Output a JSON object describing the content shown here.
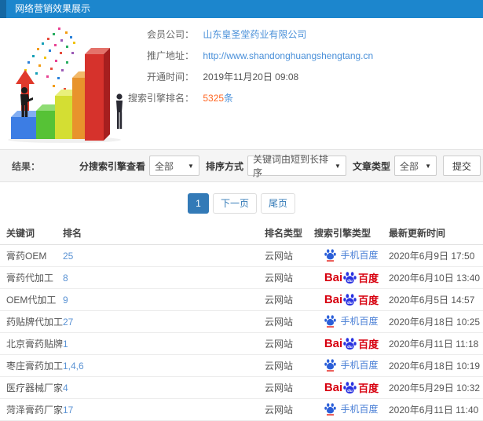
{
  "header": {
    "title": "网络营销效果展示"
  },
  "info": {
    "rows": [
      {
        "label": "会员公司：",
        "value": "山东皇圣堂药业有限公司"
      },
      {
        "label": "推广地址：",
        "value": "http://www.shandonghuangshengtang.cn"
      },
      {
        "label": "开通时间：",
        "value": "2019年11月20日 09:08"
      },
      {
        "label": "搜索引擎排名：",
        "value_number": "5325",
        "value_unit": "条"
      }
    ]
  },
  "filters": {
    "result_label": "结果：",
    "engine_filter_label": "分搜索引擎查看",
    "engine_filter_value": "全部",
    "sort_label": "排序方式",
    "sort_value": "关键词由短到长排序",
    "article_type_label": "文章类型",
    "article_type_value": "全部",
    "submit_label": "提交"
  },
  "pagination": {
    "current": "1",
    "next_label": "下一页",
    "last_label": "尾页"
  },
  "logos": {
    "mobile_label": "手机百度",
    "baidu_prefix": "Bai",
    "baidu_du": "du",
    "baidu_suffix": "百度"
  },
  "table": {
    "headers": [
      "关键词",
      "排名",
      "排名类型",
      "搜索引擎类型",
      "最新更新时间"
    ],
    "rows": [
      {
        "keyword": "膏药OEM",
        "rank": "25",
        "rank_type": "云网站",
        "engine": "mobile-baidu",
        "updated": "2020年6月9日 17:50"
      },
      {
        "keyword": "膏药代加工",
        "rank": "8",
        "rank_type": "云网站",
        "engine": "baidu",
        "updated": "2020年6月10日 13:40"
      },
      {
        "keyword": "OEM代加工",
        "rank": "9",
        "rank_type": "云网站",
        "engine": "baidu",
        "updated": "2020年6月5日 14:57"
      },
      {
        "keyword": "药贴牌代加工",
        "rank": "27",
        "rank_type": "云网站",
        "engine": "mobile-baidu",
        "updated": "2020年6月18日 10:25"
      },
      {
        "keyword": "北京膏药贴牌",
        "rank": "1",
        "rank_type": "云网站",
        "engine": "baidu",
        "updated": "2020年6月11日 11:18"
      },
      {
        "keyword": "枣庄膏药加工",
        "rank": "1,4,6",
        "rank_type": "云网站",
        "engine": "mobile-baidu",
        "updated": "2020年6月18日 10:19"
      },
      {
        "keyword": "医疗器械厂家",
        "rank": "4",
        "rank_type": "云网站",
        "engine": "baidu",
        "updated": "2020年5月29日 10:32"
      },
      {
        "keyword": "菏泽膏药厂家",
        "rank": "17",
        "rank_type": "云网站",
        "engine": "mobile-baidu",
        "updated": "2020年6月11日 11:40"
      }
    ]
  },
  "colors": {
    "titlebar_blue": "#1c86cd",
    "link_blue": "#4a90d9",
    "rank_blue": "#5b93d4",
    "highlight_orange": "#ff6622",
    "pagination_blue": "#337ab7",
    "baidu_red": "#d7000f",
    "baidu_blue": "#2932e1",
    "mobile_baidu_text": "#4a7fd6"
  }
}
